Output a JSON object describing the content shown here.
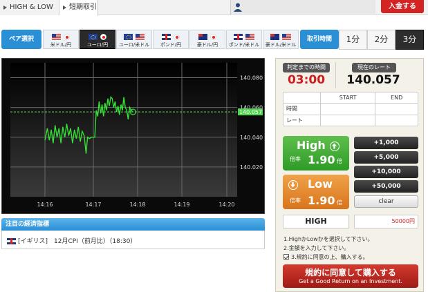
{
  "topbar": {
    "tabs": [
      {
        "label": "HIGH & LOW"
      },
      {
        "label": "短期取引"
      }
    ],
    "deposit_label": "入金する"
  },
  "pair_selector": {
    "label": "ペア選択",
    "pairs": [
      {
        "label": "米ドル/円",
        "flags": [
          "us",
          "jp"
        ],
        "active": false
      },
      {
        "label": "ユーロ/円",
        "flags": [
          "eu",
          "jp"
        ],
        "active": true
      },
      {
        "label": "ユーロ/米ドル",
        "flags": [
          "eu",
          "us"
        ],
        "active": false
      },
      {
        "label": "ポンド/円",
        "flags": [
          "gb",
          "jp"
        ],
        "active": false
      },
      {
        "label": "豪ドル/円",
        "flags": [
          "au",
          "jp"
        ],
        "active": false
      },
      {
        "label": "ポンド/米ドル",
        "flags": [
          "gb",
          "us"
        ],
        "active": false
      },
      {
        "label": "豪ドル/米ドル",
        "flags": [
          "au",
          "us"
        ],
        "active": false
      }
    ]
  },
  "period_selector": {
    "label": "取引時間",
    "options": [
      {
        "label": "1分",
        "active": false
      },
      {
        "label": "2分",
        "active": false
      },
      {
        "label": "3分",
        "active": true
      }
    ]
  },
  "chart_data": {
    "type": "line",
    "title": "",
    "xlabel": "",
    "ylabel": "",
    "x_ticks": [
      "14:16",
      "14:17",
      "14:18",
      "14:19",
      "14:20"
    ],
    "y_ticks": [
      140.02,
      140.04,
      140.06,
      140.08
    ],
    "ylim": [
      140.0,
      140.09
    ],
    "current_rate_label": "140.057",
    "current_rate": 140.057,
    "grid": true,
    "series": [
      {
        "color": "#35e035",
        "points": [
          [
            0.0,
            140.038
          ],
          [
            0.05,
            140.046
          ],
          [
            0.09,
            140.038
          ],
          [
            0.13,
            140.045
          ],
          [
            0.17,
            140.036
          ],
          [
            0.21,
            140.048
          ],
          [
            0.25,
            140.04
          ],
          [
            0.29,
            140.046
          ],
          [
            0.33,
            140.036
          ],
          [
            0.37,
            140.047
          ],
          [
            0.41,
            140.04
          ],
          [
            0.45,
            140.049
          ],
          [
            0.49,
            140.041
          ],
          [
            0.53,
            140.046
          ],
          [
            0.57,
            140.036
          ],
          [
            0.61,
            140.045
          ],
          [
            0.65,
            140.039
          ],
          [
            0.69,
            140.047
          ],
          [
            0.73,
            140.037
          ],
          [
            0.77,
            140.044
          ],
          [
            0.81,
            140.041
          ],
          [
            0.85,
            140.029
          ],
          [
            0.88,
            140.04
          ],
          [
            0.92,
            140.039
          ],
          [
            0.96,
            140.04
          ],
          [
            1.0,
            140.04
          ],
          [
            1.03,
            140.04
          ],
          [
            1.06,
            140.058
          ],
          [
            1.09,
            140.054
          ],
          [
            1.12,
            140.064
          ],
          [
            1.15,
            140.056
          ],
          [
            1.18,
            140.062
          ],
          [
            1.21,
            140.054
          ],
          [
            1.24,
            140.063
          ],
          [
            1.27,
            140.058
          ],
          [
            1.3,
            140.066
          ],
          [
            1.33,
            140.061
          ],
          [
            1.36,
            140.067
          ],
          [
            1.39,
            140.066
          ],
          [
            1.42,
            140.06
          ],
          [
            1.45,
            140.064
          ],
          [
            1.48,
            140.057
          ],
          [
            1.51,
            140.061
          ],
          [
            1.54,
            140.055
          ],
          [
            1.57,
            140.062
          ],
          [
            1.6,
            140.058
          ],
          [
            1.63,
            140.067
          ],
          [
            1.66,
            140.06
          ],
          [
            1.69,
            140.058
          ],
          [
            1.72,
            140.052
          ],
          [
            1.75,
            140.06
          ],
          [
            1.78,
            140.058
          ],
          [
            1.82,
            140.057
          ]
        ]
      }
    ]
  },
  "news": {
    "header": "注目の経済指標",
    "country": "[イギリス]",
    "item": "12月CPI（前月比）（18:30）"
  },
  "panel": {
    "time_label": "判定までの時間",
    "time_value": "03:00",
    "rate_label": "現在のレート",
    "rate_value": "140.057",
    "table": {
      "col_start": "START",
      "col_end": "END",
      "row_time": "時間",
      "row_rate": "レート"
    },
    "high": {
      "label": "High",
      "odds_label": "倍率",
      "odds_value": "1.90",
      "odds_unit": "倍"
    },
    "low": {
      "label": "Low",
      "odds_label": "倍率",
      "odds_value": "1.90",
      "odds_unit": "倍"
    },
    "amount_buttons": [
      "+1,000",
      "+5,000",
      "+10,000",
      "+50,000"
    ],
    "clear_label": "clear",
    "selected_direction": "HIGH",
    "amount_value": "50000円",
    "instructions": [
      "1.HighかLowかを選択して下さい。",
      "2.金額を入力して下さい。",
      "3.規約に同意の上、購入する。"
    ],
    "buy_label": "規約に同意して購入する",
    "buy_sub": "Get a Good Return on an Investment."
  }
}
